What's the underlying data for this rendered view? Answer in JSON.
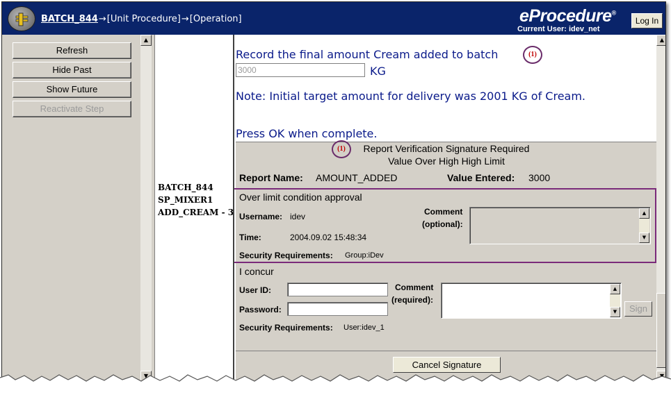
{
  "header": {
    "breadcrumb_batch": "BATCH_844",
    "breadcrumb_unit": "[Unit Procedure]",
    "breadcrumb_op": "[Operation]",
    "brand": "eProcedure",
    "brand_mark": "®",
    "current_user": "Current User: idev_net",
    "login_label": "Log In"
  },
  "sidebar": {
    "refresh": "Refresh",
    "hide_past": "Hide Past",
    "show_future": "Show Future",
    "reactivate": "Reactivate Step"
  },
  "context": {
    "batch": "BATCH_844",
    "unit": "SP_MIXER1",
    "operation": "ADD_CREAM - 3"
  },
  "instruction": {
    "record_text": "Record the final amount Cream added to batch",
    "amount_value": "3000",
    "unit": "KG",
    "note": "Note: Initial target amount for delivery was 2001 KG of Cream.",
    "press_ok": "Press OK when complete.",
    "marker": "(1)"
  },
  "verification": {
    "marker": "(1)",
    "title": "Report Verification Signature Required",
    "subtitle": "Value Over High High Limit",
    "report_name_label": "Report Name:",
    "report_name": "AMOUNT_ADDED",
    "value_entered_label": "Value Entered:",
    "value_entered": "3000"
  },
  "approval": {
    "heading": "Over limit condition approval",
    "username_label": "Username:",
    "username": "idev",
    "time_label": "Time:",
    "time": "2004.09.02 15:48:34",
    "comment_label": "Comment",
    "comment_optional": "(optional):",
    "security_label": "Security Requirements:",
    "security_value": "Group:iDev"
  },
  "concur": {
    "heading": "I concur",
    "userid_label": "User ID:",
    "password_label": "Password:",
    "comment_label": "Comment",
    "comment_required": "(required):",
    "sign_label": "Sign",
    "security_label": "Security Requirements:",
    "security_value": "User:idev_1"
  },
  "cancel_label": "Cancel Signature",
  "colors": {
    "header_bg": "#0a246a",
    "instruction_text": "#0a1a8a",
    "highlight_border": "#7a2a7a",
    "marker_text": "#c00000"
  },
  "icons": [
    "logo-icon",
    "arrow-right-icon",
    "scroll-up-icon",
    "scroll-down-icon"
  ]
}
